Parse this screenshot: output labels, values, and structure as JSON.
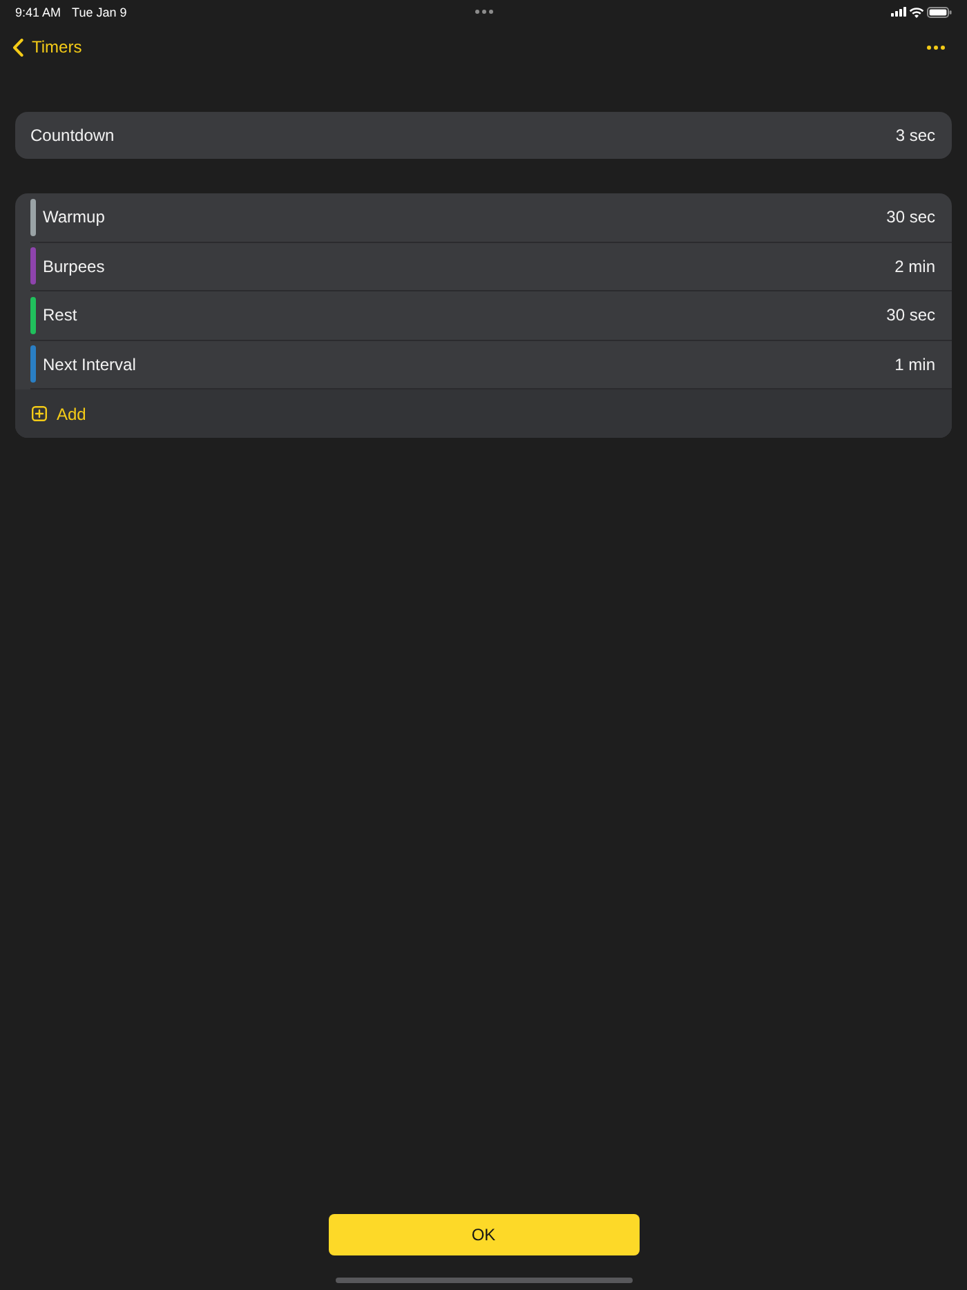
{
  "status_bar": {
    "time": "9:41 AM",
    "date": "Tue Jan 9"
  },
  "nav_bar": {
    "back_label": "Timers"
  },
  "countdown": {
    "label": "Countdown",
    "value": "3 sec"
  },
  "intervals": [
    {
      "name": "Warmup",
      "duration": "30 sec",
      "color": "#9aa3a6"
    },
    {
      "name": "Burpees",
      "duration": "2 min",
      "color": "#8e44ad"
    },
    {
      "name": "Rest",
      "duration": "30 sec",
      "color": "#20c05c"
    },
    {
      "name": "Next Interval",
      "duration": "1 min",
      "color": "#2a7fc4"
    }
  ],
  "add_button": {
    "label": "Add"
  },
  "ok_button": {
    "label": "OK"
  }
}
